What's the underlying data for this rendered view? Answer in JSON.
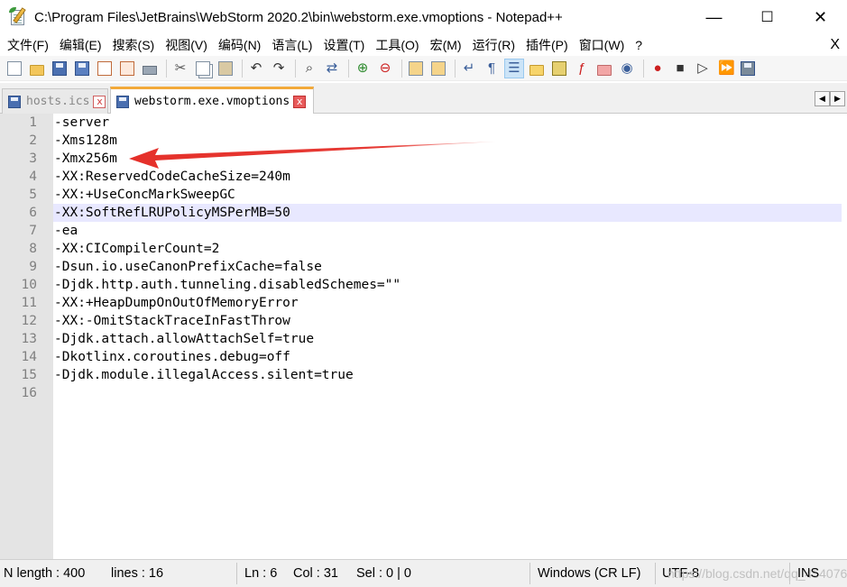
{
  "window": {
    "title": "C:\\Program Files\\JetBrains\\WebStorm 2020.2\\bin\\webstorm.exe.vmoptions - Notepad++",
    "minimize": "—",
    "maximize": "☐",
    "close": "✕"
  },
  "menu": {
    "items": [
      "文件(F)",
      "编辑(E)",
      "搜索(S)",
      "视图(V)",
      "编码(N)",
      "语言(L)",
      "设置(T)",
      "工具(O)",
      "宏(M)",
      "运行(R)",
      "插件(P)",
      "窗口(W)",
      "?"
    ],
    "close": "X"
  },
  "toolbar": {
    "icons": [
      "new-file-icon",
      "open-file-icon",
      "save-icon",
      "save-all-icon",
      "close-icon",
      "close-all-icon",
      "print-icon",
      "cut-icon",
      "copy-icon",
      "paste-icon",
      "undo-icon",
      "redo-icon",
      "find-icon",
      "replace-icon",
      "zoom-in-icon",
      "zoom-out-icon",
      "sync-vertical-icon",
      "sync-horizontal-icon",
      "word-wrap-icon",
      "show-all-chars-icon",
      "indent-guide-icon",
      "user-lang-icon",
      "doc-map-icon",
      "function-list-icon",
      "folder-workspace-icon",
      "monitoring-icon",
      "record-macro-icon",
      "stop-macro-icon",
      "play-macro-icon",
      "run-macro-multiple-icon",
      "save-macro-icon"
    ]
  },
  "tabs": {
    "inactive_label": "hosts.ics",
    "active_label": "webstorm.exe.vmoptions",
    "close_glyph": "x",
    "prev": "◀",
    "next": "▶"
  },
  "editor": {
    "current_line": 6,
    "lines": [
      "-server",
      "-Xms128m",
      "-Xmx256m",
      "-XX:ReservedCodeCacheSize=240m",
      "-XX:+UseConcMarkSweepGC",
      "-XX:SoftRefLRUPolicyMSPerMB=50",
      "-ea",
      "-XX:CICompilerCount=2",
      "-Dsun.io.useCanonPrefixCache=false",
      "-Djdk.http.auth.tunneling.disabledSchemes=\"\"",
      "-XX:+HeapDumpOnOutOfMemoryError",
      "-XX:-OmitStackTraceInFastThrow",
      "-Djdk.attach.allowAttachSelf=true",
      "-Dkotlinx.coroutines.debug=off",
      "-Djdk.module.illegalAccess.silent=true",
      ""
    ],
    "annotation_color": "#e5302a"
  },
  "status": {
    "length": "N length : 400",
    "lines": "lines : 16",
    "ln": "Ln : 6",
    "col": "Col : 31",
    "sel": "Sel : 0 | 0",
    "eol": "Windows (CR LF)",
    "encoding": "UTF-8",
    "mode": "INS",
    "watermark": "https://blog.csdn.net/qq_45407627"
  }
}
